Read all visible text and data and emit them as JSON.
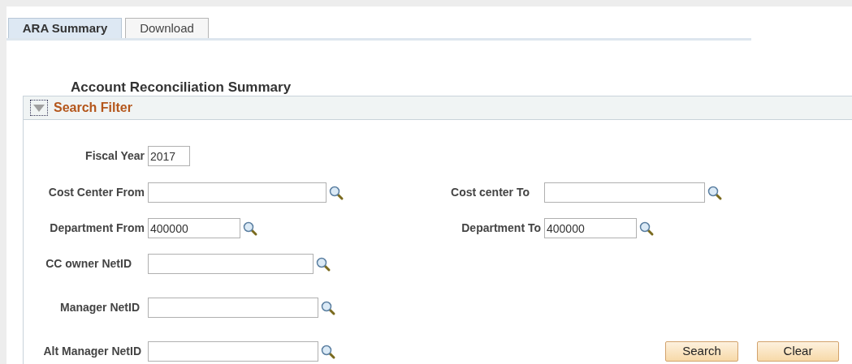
{
  "tabs": [
    {
      "label": "ARA Summary",
      "selected": true
    },
    {
      "label": "Download",
      "selected": false
    }
  ],
  "page_title": "Account Reconciliation Summary",
  "search_filter": {
    "title": "Search Filter",
    "expanded": true
  },
  "rows": [
    {
      "left": {
        "label": "Fiscal Year",
        "value": "2017",
        "lookup": false
      }
    },
    {
      "left": {
        "label": "Cost Center From",
        "lookup": true
      },
      "right": {
        "label": "Cost center To",
        "lookup": true
      }
    },
    {
      "left": {
        "label": "Department From",
        "value": "400000",
        "lookup": true
      },
      "right": {
        "label": "Department To",
        "value": "400000",
        "lookup": true
      }
    },
    {
      "left": {
        "label": "CC owner NetID",
        "lookup": true
      }
    },
    {
      "left": {
        "label": "Manager NetID",
        "lookup": true
      }
    },
    {
      "left": {
        "label": "Alt Manager NetID",
        "lookup": true
      }
    }
  ],
  "buttons": [
    "Search",
    "Clear"
  ]
}
